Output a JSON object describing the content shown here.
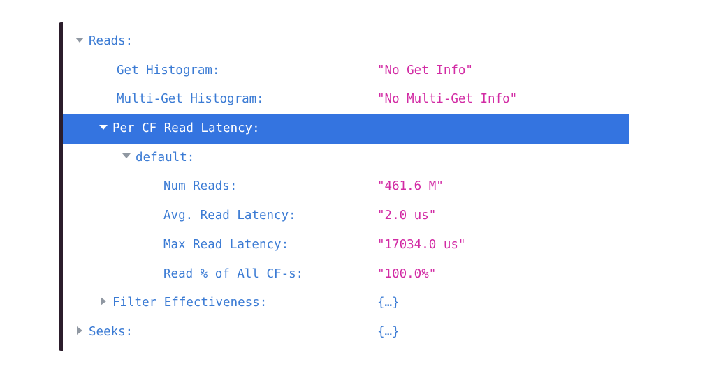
{
  "tree": {
    "reads": {
      "label": "Reads:",
      "expanded": true,
      "get_histogram": {
        "key": "Get Histogram:",
        "value": "\"No Get Info\""
      },
      "multi_get_histogram": {
        "key": "Multi-Get Histogram:",
        "value": "\"No Multi-Get Info\""
      },
      "per_cf_read_latency": {
        "label": "Per CF Read Latency:",
        "expanded": true,
        "selected": true,
        "default": {
          "label": "default:",
          "expanded": true,
          "num_reads": {
            "key": "Num Reads:",
            "value": "\"461.6 M\""
          },
          "avg_read_latency": {
            "key": "Avg. Read Latency:",
            "value": "\"2.0 us\""
          },
          "max_read_latency": {
            "key": "Max Read Latency:",
            "value": "\"17034.0 us\""
          },
          "read_pct": {
            "key": "Read % of All CF-s:",
            "value": "\"100.0%\""
          }
        }
      },
      "filter_effectiveness": {
        "label": "Filter Effectiveness:",
        "value": "{…}",
        "expanded": false
      }
    },
    "seeks": {
      "label": "Seeks:",
      "value": "{…}",
      "expanded": false
    }
  },
  "colors": {
    "key": "#3b7bd4",
    "string_value": "#d22ba4",
    "selection": "#3474e0",
    "twisty": "#9098a2",
    "left_bar": "#2b1d2b"
  },
  "icons": {
    "expanded": "triangle-down-icon",
    "collapsed": "triangle-right-icon"
  }
}
